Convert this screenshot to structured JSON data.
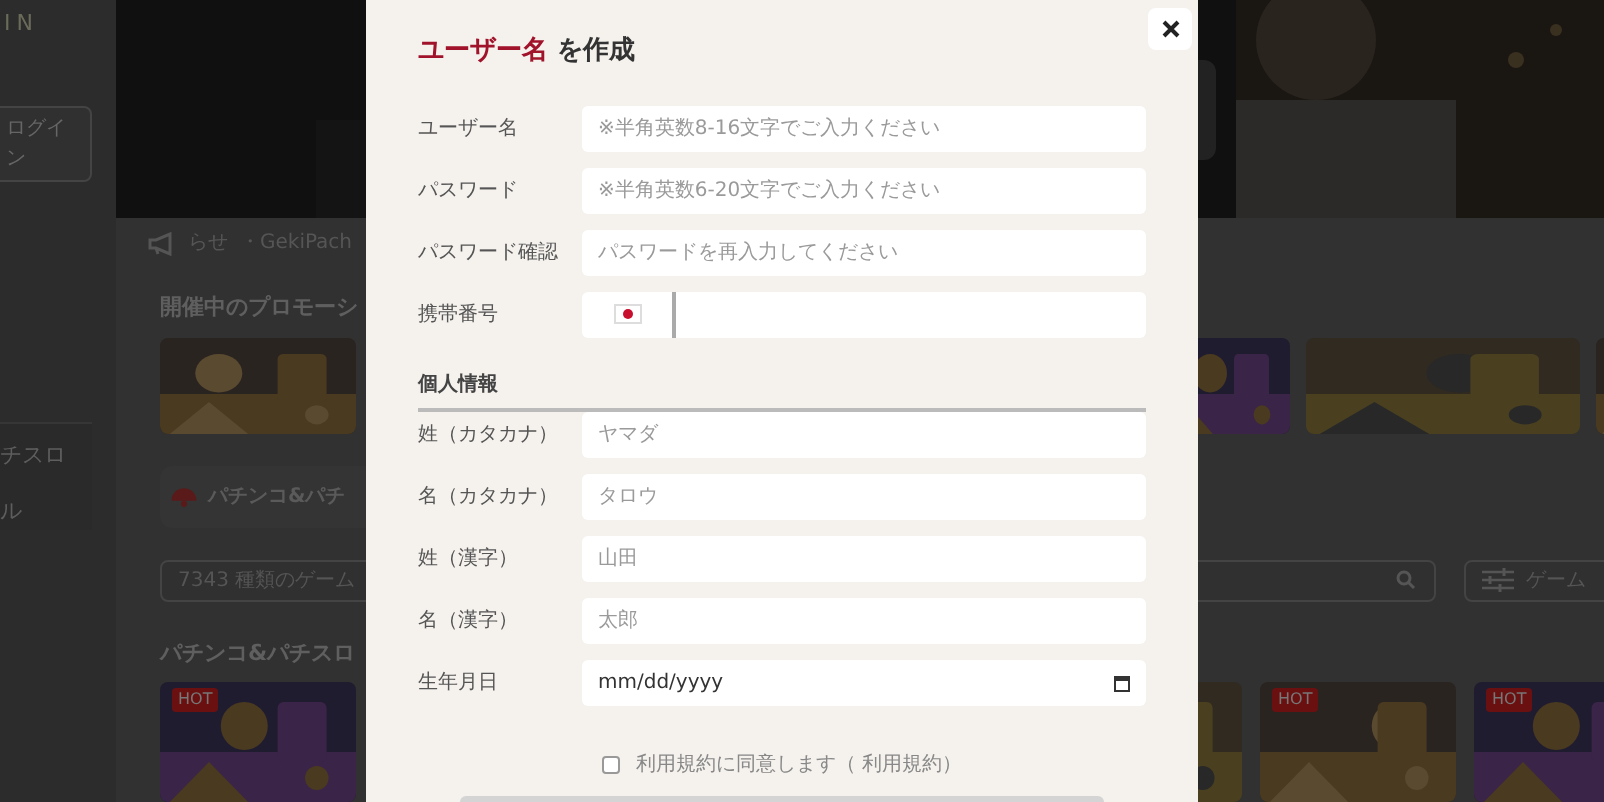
{
  "page": {
    "logo": "IN",
    "login_button": "ログイン",
    "sidebar_items": [
      {
        "label": "チスロ"
      },
      {
        "label": "ル"
      }
    ],
    "announcement": [
      "らせ",
      "・GekiPach"
    ],
    "promo_heading": "開催中のプロモーシ",
    "category_tab": "パチンコ&パチ",
    "search": {
      "placeholder": "7343 種類のゲーム"
    },
    "filter_button": "ゲーム",
    "games_heading": "パチンコ&パチスロ",
    "games": [
      {
        "kind": "picture",
        "badge": "HOT"
      },
      {
        "kind": "picture"
      },
      {
        "kind": "picture",
        "badge": "HOT"
      },
      {
        "kind": "picture",
        "badge": "HOT"
      }
    ]
  },
  "modal": {
    "title_accent": "ユーザー名",
    "title_rest": "を作成",
    "fields": [
      {
        "kind": "text",
        "label": "ユーザー名",
        "placeholder": "※半角英数8-16文字でご入力ください"
      },
      {
        "kind": "text",
        "label": "パスワード",
        "placeholder": "※半角英数6-20文字でご入力ください"
      },
      {
        "kind": "text",
        "label": "パスワード確認",
        "placeholder": "パスワードを再入力してください"
      },
      {
        "kind": "phone",
        "label": "携帯番号"
      }
    ],
    "section": "個人情報",
    "personal_fields": [
      {
        "kind": "text",
        "label": "姓（カタカナ）",
        "placeholder": "ヤマダ"
      },
      {
        "kind": "text",
        "label": "名（カタカナ）",
        "placeholder": "タロウ"
      },
      {
        "kind": "text",
        "label": "姓（漢字）",
        "placeholder": "山田"
      },
      {
        "kind": "text",
        "label": "名（漢字）",
        "placeholder": "太郎"
      },
      {
        "kind": "date",
        "label": "生年月日",
        "placeholder": "mm/dd/yyyy"
      }
    ],
    "terms": {
      "label": "利用規約に同意します（ 利用規約）",
      "checked": false
    }
  }
}
